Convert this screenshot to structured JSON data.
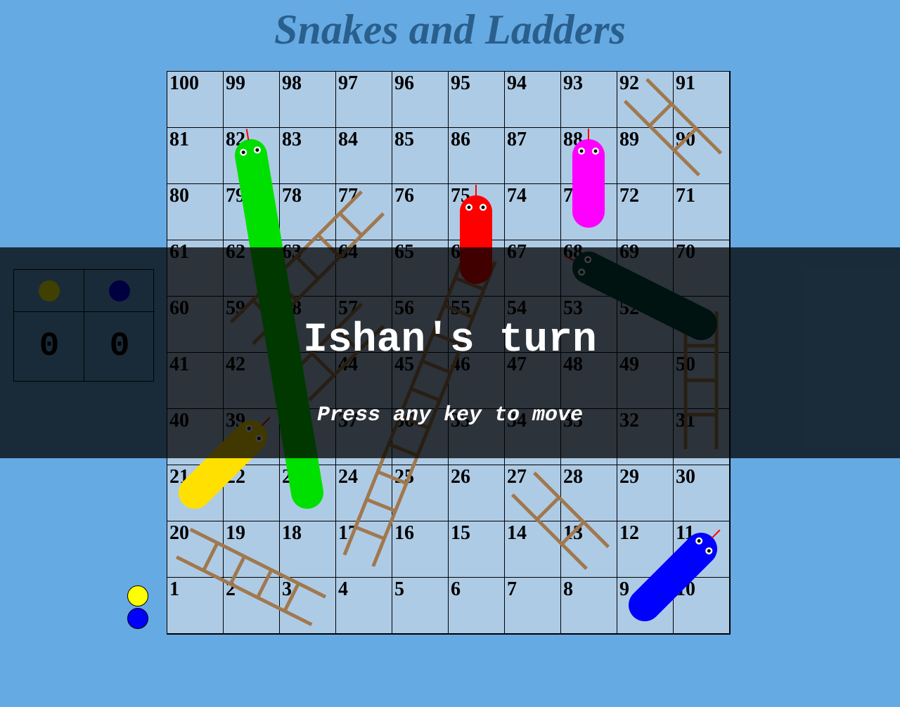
{
  "title": "Snakes and Ladders",
  "board": {
    "rows": [
      [
        100,
        99,
        98,
        97,
        96,
        95,
        94,
        93,
        92,
        91
      ],
      [
        81,
        82,
        83,
        84,
        85,
        86,
        87,
        88,
        89,
        90
      ],
      [
        80,
        79,
        78,
        77,
        76,
        75,
        74,
        73,
        72,
        71
      ],
      [
        61,
        62,
        63,
        64,
        65,
        66,
        67,
        68,
        69,
        70
      ],
      [
        60,
        59,
        58,
        57,
        56,
        55,
        54,
        53,
        52,
        51
      ],
      [
        41,
        42,
        43,
        44,
        45,
        46,
        47,
        48,
        49,
        50
      ],
      [
        40,
        39,
        38,
        37,
        36,
        35,
        34,
        33,
        32,
        31
      ],
      [
        21,
        22,
        23,
        24,
        25,
        26,
        27,
        28,
        29,
        30
      ],
      [
        20,
        19,
        18,
        17,
        16,
        15,
        14,
        13,
        12,
        11
      ],
      [
        1,
        2,
        3,
        4,
        5,
        6,
        7,
        8,
        9,
        10
      ]
    ]
  },
  "snakes": [
    {
      "color": "#00e000",
      "head_square": 82,
      "tail_square": 23
    },
    {
      "color": "#ff00ff",
      "head_square": 88,
      "tail_square": 73
    },
    {
      "color": "#ff0000",
      "head_square": 75,
      "tail_square": 66
    },
    {
      "color": "#004d44",
      "head_square": 68,
      "tail_square": 51
    },
    {
      "color": "#ffe000",
      "head_square": 39,
      "tail_square": 21
    },
    {
      "color": "#0000ff",
      "head_square": 11,
      "tail_square": 9
    }
  ],
  "ladders": [
    {
      "color": "#a0784e",
      "bottom_square": 59,
      "top_square": 77
    },
    {
      "color": "#a0784e",
      "bottom_square": 43,
      "top_square": 57
    },
    {
      "color": "#a0784e",
      "bottom_square": 17,
      "top_square": 66
    },
    {
      "color": "#a0784e",
      "bottom_square": 13,
      "top_square": 27
    },
    {
      "color": "#a0784e",
      "bottom_square": 31,
      "top_square": 51
    },
    {
      "color": "#a0784e",
      "bottom_square": 3,
      "top_square": 20
    },
    {
      "color": "#a0784e",
      "bottom_square": 90,
      "top_square": 92
    }
  ],
  "players": [
    {
      "color": "#ffff00",
      "score": "0"
    },
    {
      "color": "#0000ff",
      "score": "0"
    }
  ],
  "banner": {
    "turn_text": "Ishan's turn",
    "prompt_text": "Press any key to move"
  }
}
